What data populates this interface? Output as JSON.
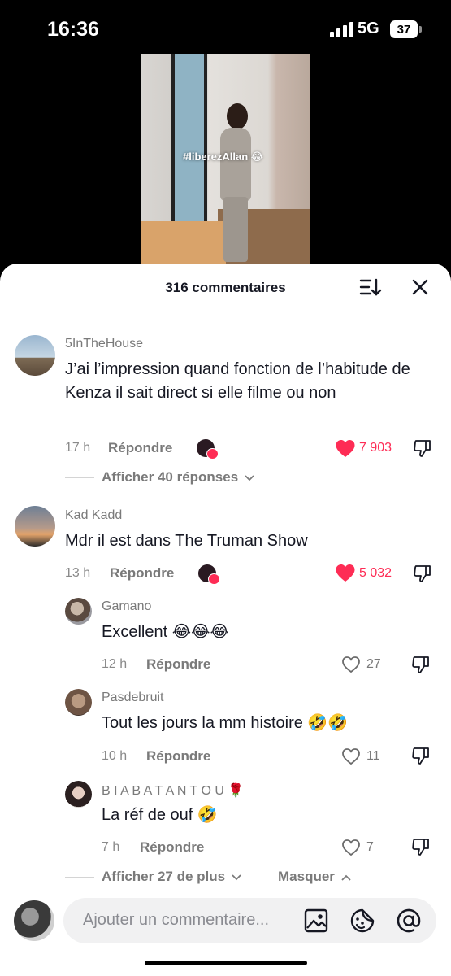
{
  "status": {
    "time": "16:36",
    "network": "5G",
    "battery": "37"
  },
  "video": {
    "caption": "#liberezAllan 😂"
  },
  "sheet": {
    "title": "316 commentaires"
  },
  "comments": [
    {
      "user": "5InTheHouse",
      "text": "J’ai l’impression quand fonction de l’habitude de Kenza il sait direct si elle filme ou non",
      "time": "17 h",
      "reply_label": "Répondre",
      "likes": "7 903",
      "view_replies": "Afficher 40 réponses"
    },
    {
      "user": "Kad Kadd",
      "text": "Mdr il est dans The Truman Show",
      "time": "13 h",
      "reply_label": "Répondre",
      "likes": "5 032",
      "replies": [
        {
          "user": "Gamano",
          "text": "Excellent 😂😂😂",
          "time": "12 h",
          "reply_label": "Répondre",
          "likes": "27"
        },
        {
          "user": "Pasdebruit",
          "text": "Tout les jours la mm histoire 🤣🤣",
          "time": "10 h",
          "reply_label": "Répondre",
          "likes": "11"
        },
        {
          "user": "B I A B A T A N T O U 🌹",
          "text": "La réf de ouf 🤣",
          "time": "7 h",
          "reply_label": "Répondre",
          "likes": "7"
        }
      ],
      "view_more": "Afficher 27 de plus",
      "hide_label": "Masquer"
    }
  ],
  "input": {
    "placeholder": "Ajouter un commentaire..."
  },
  "colors": {
    "like_red": "#fe2c55",
    "text_primary": "#161823",
    "text_secondary": "#7a7a7a"
  }
}
